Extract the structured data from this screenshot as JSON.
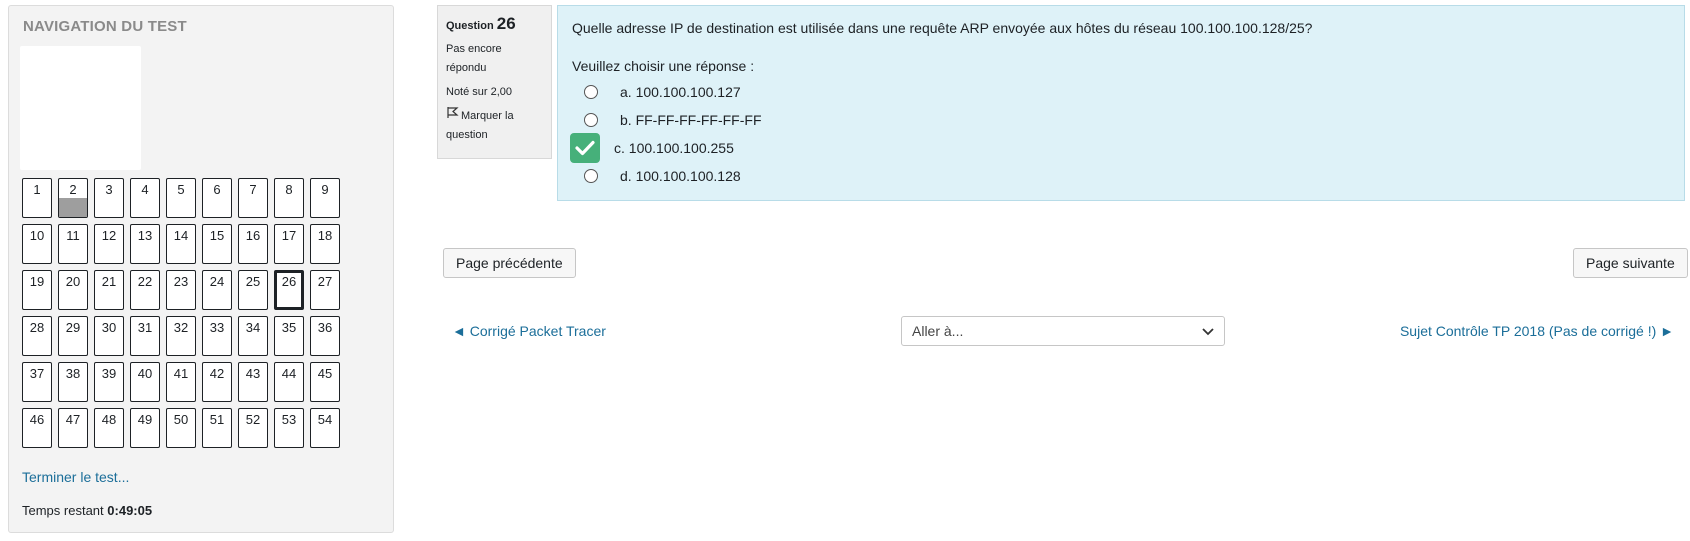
{
  "nav": {
    "title": "NAVIGATION DU TEST",
    "questions": [
      "1",
      "2",
      "3",
      "4",
      "5",
      "6",
      "7",
      "8",
      "9",
      "10",
      "11",
      "12",
      "13",
      "14",
      "15",
      "16",
      "17",
      "18",
      "19",
      "20",
      "21",
      "22",
      "23",
      "24",
      "25",
      "26",
      "27",
      "28",
      "29",
      "30",
      "31",
      "32",
      "33",
      "34",
      "35",
      "36",
      "37",
      "38",
      "39",
      "40",
      "41",
      "42",
      "43",
      "44",
      "45",
      "46",
      "47",
      "48",
      "49",
      "50",
      "51",
      "52",
      "53",
      "54"
    ],
    "answered": [
      "2"
    ],
    "current": "26",
    "finish_link": "Terminer le test...",
    "time_label": "Temps restant",
    "time_value": "0:49:05"
  },
  "qinfo": {
    "label": "Question",
    "number": "26",
    "state": "Pas encore répondu",
    "grade": "Noté sur 2,00",
    "flag": "Marquer la question"
  },
  "question": {
    "text": "Quelle adresse IP de destination est utilisée dans une requête ARP envoyée aux hôtes du réseau 100.100.100.128/25?",
    "prompt": "Veuillez choisir une réponse :",
    "answers": [
      {
        "label": "a. 100.100.100.127",
        "selected": false
      },
      {
        "label": "b. FF-FF-FF-FF-FF-FF",
        "selected": false
      },
      {
        "label": "c. 100.100.100.255",
        "selected": true
      },
      {
        "label": "d. 100.100.100.128",
        "selected": false
      }
    ],
    "check_color": "#46b07a"
  },
  "buttons": {
    "prev": "Page précédente",
    "next": "Page suivante"
  },
  "activity_nav": {
    "prev": "◄ Corrigé Packet Tracer",
    "jump_placeholder": "Aller à...",
    "next": "Sujet Contrôle TP 2018 (Pas de corrigé !) ►"
  }
}
